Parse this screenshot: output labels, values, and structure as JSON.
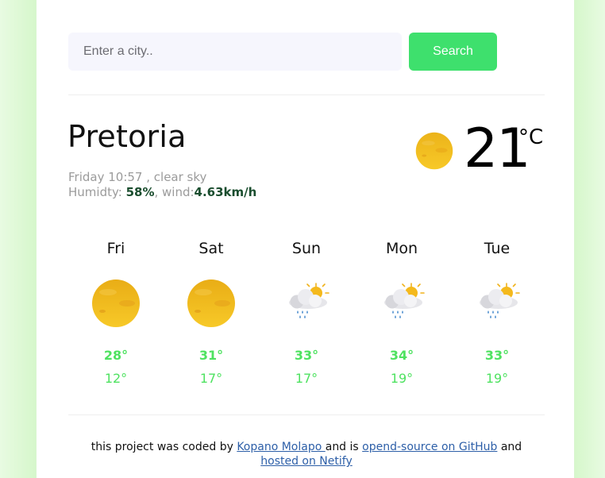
{
  "search": {
    "placeholder": "Enter a city..",
    "button_label": "Search"
  },
  "current": {
    "city": "Pretoria",
    "day_time": "Friday 10:57",
    "separator": " , ",
    "description": "clear sky",
    "humidity_label": "Humidty: ",
    "humidity_value": "58%",
    "wind_label": ", wind:",
    "wind_value": "4.63km/h",
    "temperature": "21",
    "unit": "°C",
    "icon": "sun-icon"
  },
  "forecast": [
    {
      "day": "Fri",
      "icon": "sun-icon",
      "high": "28°",
      "low": "12°"
    },
    {
      "day": "Sat",
      "icon": "sun-icon",
      "high": "31°",
      "low": "17°"
    },
    {
      "day": "Sun",
      "icon": "rain-cloud-sun-icon",
      "high": "33°",
      "low": "17°"
    },
    {
      "day": "Mon",
      "icon": "rain-cloud-sun-icon",
      "high": "34°",
      "low": "19°"
    },
    {
      "day": "Tue",
      "icon": "rain-cloud-sun-icon",
      "high": "33°",
      "low": "19°"
    }
  ],
  "footer": {
    "text_1": "this project was coded by ",
    "author": "Kopano Molapo ",
    "text_2": "and is ",
    "repo_link": "opend-source on GitHub",
    "text_3": " and ",
    "host_link": "hosted on Netify"
  },
  "colors": {
    "accent": "#3ee06d",
    "temp_text": "#4ee260",
    "link": "#2d5fa8",
    "page_background": "#e5fbde"
  }
}
